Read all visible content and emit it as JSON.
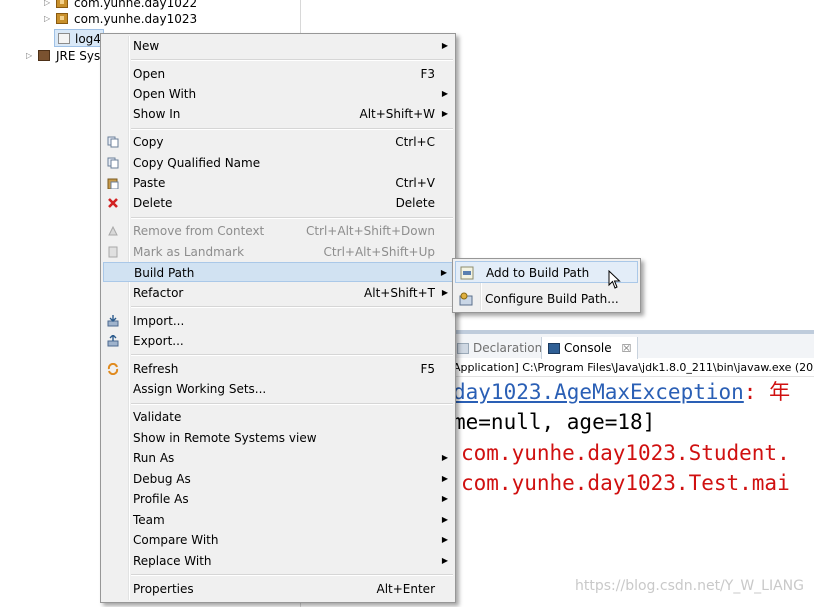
{
  "explorer": {
    "rows": [
      {
        "label": "com.yunhe.day1022",
        "icon": "package-icon"
      },
      {
        "label": "com.yunhe.day1023",
        "icon": "package-icon"
      },
      {
        "label": "log4",
        "icon": "file-icon"
      },
      {
        "label": "JRE Syst",
        "icon": "library-icon"
      }
    ]
  },
  "context_menu": {
    "items": [
      {
        "label": "New",
        "submenu": true
      },
      {
        "label": "Open",
        "accel": "F3"
      },
      {
        "label": "Open With",
        "submenu": true
      },
      {
        "label": "Show In",
        "accel": "Alt+Shift+W",
        "submenu": true
      },
      {
        "label": "Copy",
        "accel": "Ctrl+C",
        "icon": "copy-icon"
      },
      {
        "label": "Copy Qualified Name",
        "icon": "copy-qualified-icon"
      },
      {
        "label": "Paste",
        "accel": "Ctrl+V",
        "icon": "paste-icon"
      },
      {
        "label": "Delete",
        "accel": "Delete",
        "icon": "delete-icon"
      },
      {
        "label": "Remove from Context",
        "accel": "Ctrl+Alt+Shift+Down",
        "disabled": true,
        "icon": "remove-context-icon"
      },
      {
        "label": "Mark as Landmark",
        "accel": "Ctrl+Alt+Shift+Up",
        "disabled": true,
        "icon": "landmark-icon"
      },
      {
        "label": "Build Path",
        "submenu": true,
        "highlighted": true
      },
      {
        "label": "Refactor",
        "accel": "Alt+Shift+T",
        "submenu": true
      },
      {
        "label": "Import...",
        "icon": "import-icon"
      },
      {
        "label": "Export...",
        "icon": "export-icon"
      },
      {
        "label": "Refresh",
        "accel": "F5",
        "icon": "refresh-icon"
      },
      {
        "label": "Assign Working Sets..."
      },
      {
        "label": "Validate"
      },
      {
        "label": "Show in Remote Systems view"
      },
      {
        "label": "Run As",
        "submenu": true
      },
      {
        "label": "Debug As",
        "submenu": true
      },
      {
        "label": "Profile As",
        "submenu": true
      },
      {
        "label": "Team",
        "submenu": true
      },
      {
        "label": "Compare With",
        "submenu": true
      },
      {
        "label": "Replace With",
        "submenu": true
      },
      {
        "label": "Properties",
        "accel": "Alt+Enter"
      }
    ]
  },
  "build_path_submenu": {
    "items": [
      {
        "label": "Add to Build Path",
        "icon": "add-build-path-icon",
        "highlighted": true
      },
      {
        "label": "Configure Build Path...",
        "icon": "configure-build-path-icon"
      }
    ]
  },
  "console": {
    "tabs": [
      {
        "label": "Declaration",
        "icon": "declaration-icon"
      },
      {
        "label": "Console",
        "icon": "console-icon",
        "active": true
      }
    ],
    "close_glyph": "☒",
    "path": "Application] C:\\Program Files\\Java\\jdk1.8.0_211\\bin\\javaw.exe (202",
    "lines": [
      {
        "link": "day1023.AgeMaxException",
        "rest": ": 年"
      },
      {
        "text": "me=null, age=18]"
      },
      {
        "text": "com.yunhe.day1023.Student."
      },
      {
        "text": "com.yunhe.day1023.Test.mai"
      }
    ]
  },
  "watermark": "https://blog.csdn.net/Y_W_LIANG",
  "colors": {
    "menu_bg": "#f0f0f0",
    "highlight": "#d1e2f2",
    "error_red": "#d01010",
    "link_blue": "#2a5fb5"
  }
}
